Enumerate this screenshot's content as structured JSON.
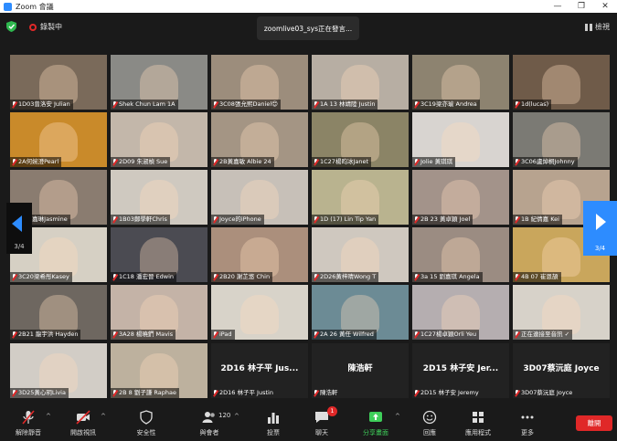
{
  "window": {
    "title": "Zoom 會議",
    "controls": [
      "—",
      "❐",
      "✕"
    ]
  },
  "topbar": {
    "recording": "錄製中",
    "speaker": "zoomlive03_sys正在發言...",
    "view": "檢視"
  },
  "participants": [
    {
      "name": "1D03曾洛安 Julian",
      "cam": true,
      "bg": "#7a6a5a"
    },
    {
      "name": "Shek Chun Lam 1A",
      "cam": true,
      "bg": "#8a8a86"
    },
    {
      "name": "3C08張允熙Daniel😊",
      "cam": true,
      "bg": "#9c8d7c"
    },
    {
      "name": "1A 13 林靖陸 Justin",
      "cam": true,
      "bg": "#b7aea3"
    },
    {
      "name": "3C19梁亦瑜 Andrea",
      "cam": true,
      "bg": "#8d8370"
    },
    {
      "name": "1d(lucas)",
      "cam": true,
      "bg": "#6f5b49"
    },
    {
      "name": "2A何婉澄Pearl",
      "cam": true,
      "bg": "#c98a2a"
    },
    {
      "name": "2D09 朱淑楨 Sue",
      "cam": true,
      "bg": "#c3b7aa"
    },
    {
      "name": "2B黃嘉敏 Albie 24",
      "cam": true,
      "bg": "#a49584"
    },
    {
      "name": "1C27楊昀冰Janet",
      "cam": true,
      "bg": "#8b8466"
    },
    {
      "name": "Jolie 黃琪琪",
      "cam": true,
      "bg": "#d8d4d0"
    },
    {
      "name": "3C06盧焯桐Johnny",
      "cam": true,
      "bg": "#7b7a74"
    },
    {
      "name": "2C鄭嘉琳Jasmine",
      "cam": true,
      "bg": "#8a7c70"
    },
    {
      "name": "1B03鄭學軒Chris",
      "cam": true,
      "bg": "#cfc9c0"
    },
    {
      "name": "Joyce的iPhone",
      "cam": true,
      "bg": "#c7c0b8"
    },
    {
      "name": "1D (17) Lin Tip Yan",
      "cam": true,
      "bg": "#b9b38f"
    },
    {
      "name": "2B 23 黃卓穎 Joel",
      "cam": true,
      "bg": "#a3938a"
    },
    {
      "name": "1B 紀倩嘉 Kei",
      "cam": true,
      "bg": "#b7a38f"
    },
    {
      "name": "3C20梁希彤Kasey",
      "cam": true,
      "bg": "#d6d0c4"
    },
    {
      "name": "1C18 潘宏晉 Edwin",
      "cam": true,
      "bg": "#4b4b52"
    },
    {
      "name": "2B20 謝芷悠 Chin",
      "cam": true,
      "bg": "#ab8f7c"
    },
    {
      "name": "2D26黃梓晴Wong T",
      "cam": true,
      "bg": "#cfc8bf"
    },
    {
      "name": "3a 15 劉嘉琪 Angela",
      "cam": true,
      "bg": "#9b8c82"
    },
    {
      "name": "4B 07 崔恩頡",
      "cam": true,
      "bg": "#c9a65c"
    },
    {
      "name": "2B21 龍宇洪 Hayden",
      "cam": true,
      "bg": "#6e6760"
    },
    {
      "name": "3A28 楊曉鍆 Mavis",
      "cam": true,
      "bg": "#c4b3a7"
    },
    {
      "name": "iPad",
      "cam": true,
      "bg": "#d8d3c9"
    },
    {
      "name": "2A 26 黃任 Wilfred",
      "cam": true,
      "bg": "#6c8b95"
    },
    {
      "name": "1C27楊卓穎Orli Yeu",
      "cam": true,
      "bg": "#b5aeb0"
    },
    {
      "name": "正在連接至音訊 ✓",
      "cam": true,
      "bg": "#d7d2c9"
    },
    {
      "name": "3D25黃心玥Livia",
      "cam": true,
      "bg": "#d2cdc6"
    },
    {
      "name": "2B 8 劉子謙 Raphae",
      "cam": true,
      "bg": "#bdb19e"
    },
    {
      "name": "2D16 林子平 Justin",
      "cam": false,
      "big": "2D16 林子平 Jus..."
    },
    {
      "name": "陳浩軒",
      "cam": false,
      "big": "陳浩軒"
    },
    {
      "name": "2D15 林子安 Jeremy",
      "cam": false,
      "big": "2D15 林子安 Jer..."
    },
    {
      "name": "3D07蔡沅庭 Joyce",
      "cam": false,
      "big": "3D07蔡沅庭 Joyce"
    }
  ],
  "paging": {
    "left": "3/4",
    "right": "3/4"
  },
  "toolbar": {
    "unmute": "解除靜音",
    "start_video": "開啟視訊",
    "security": "安全性",
    "participants": "與會者",
    "participants_count": "120",
    "polls": "投票",
    "chat": "聊天",
    "chat_badge": "1",
    "share": "分享畫面",
    "reactions": "回應",
    "apps": "應用程式",
    "more": "更多",
    "end": "離開"
  },
  "colors": {
    "accent": "#2d8cff",
    "danger": "#e02828",
    "share": "#3ecf5a"
  }
}
